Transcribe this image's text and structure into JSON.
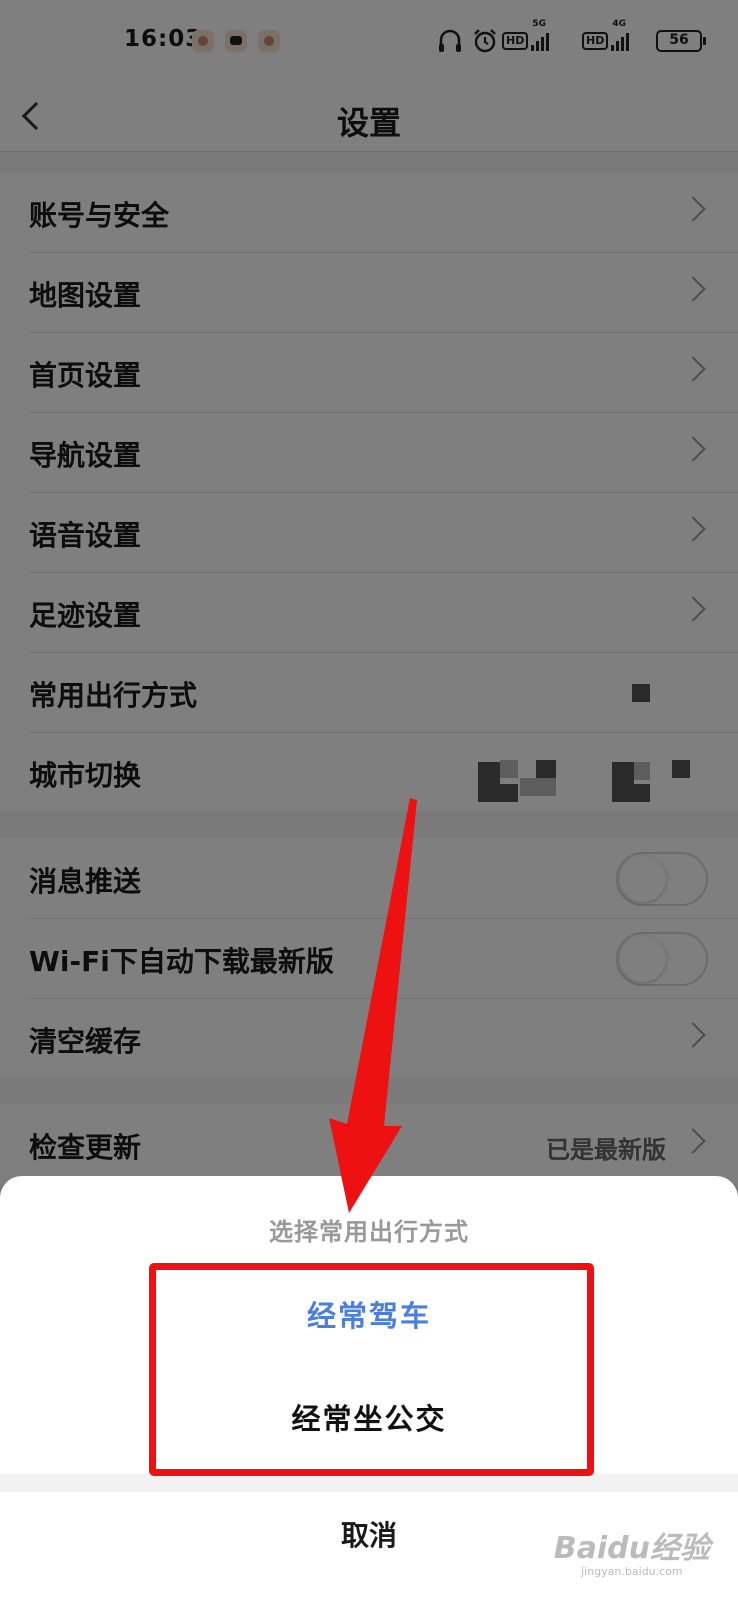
{
  "status_bar": {
    "time": "16:03",
    "hd_label": "HD",
    "net_5g": "5G",
    "net_4g": "4G",
    "battery": "56"
  },
  "nav": {
    "title": "设置"
  },
  "settings": {
    "account": "账号与安全",
    "map": "地图设置",
    "home": "首页设置",
    "navigation": "导航设置",
    "voice": "语音设置",
    "footprint": "足迹设置",
    "travel_mode": "常用出行方式",
    "city_switch": "城市切换",
    "push": "消息推送",
    "wifi_download": "Wi-Fi下自动下载最新版",
    "clear_cache": "清空缓存",
    "check_update": "检查更新",
    "update_status": "已是最新版"
  },
  "sheet": {
    "title": "选择常用出行方式",
    "option_drive": "经常驾车",
    "option_bus": "经常坐公交",
    "cancel": "取消"
  },
  "colors": {
    "selected_option": "#4a7ee0",
    "highlight_box": "#ee1111",
    "arrow": "#ee1111"
  },
  "watermark": {
    "brand": "Baidu经验",
    "url": "jingyan.baidu.com"
  }
}
